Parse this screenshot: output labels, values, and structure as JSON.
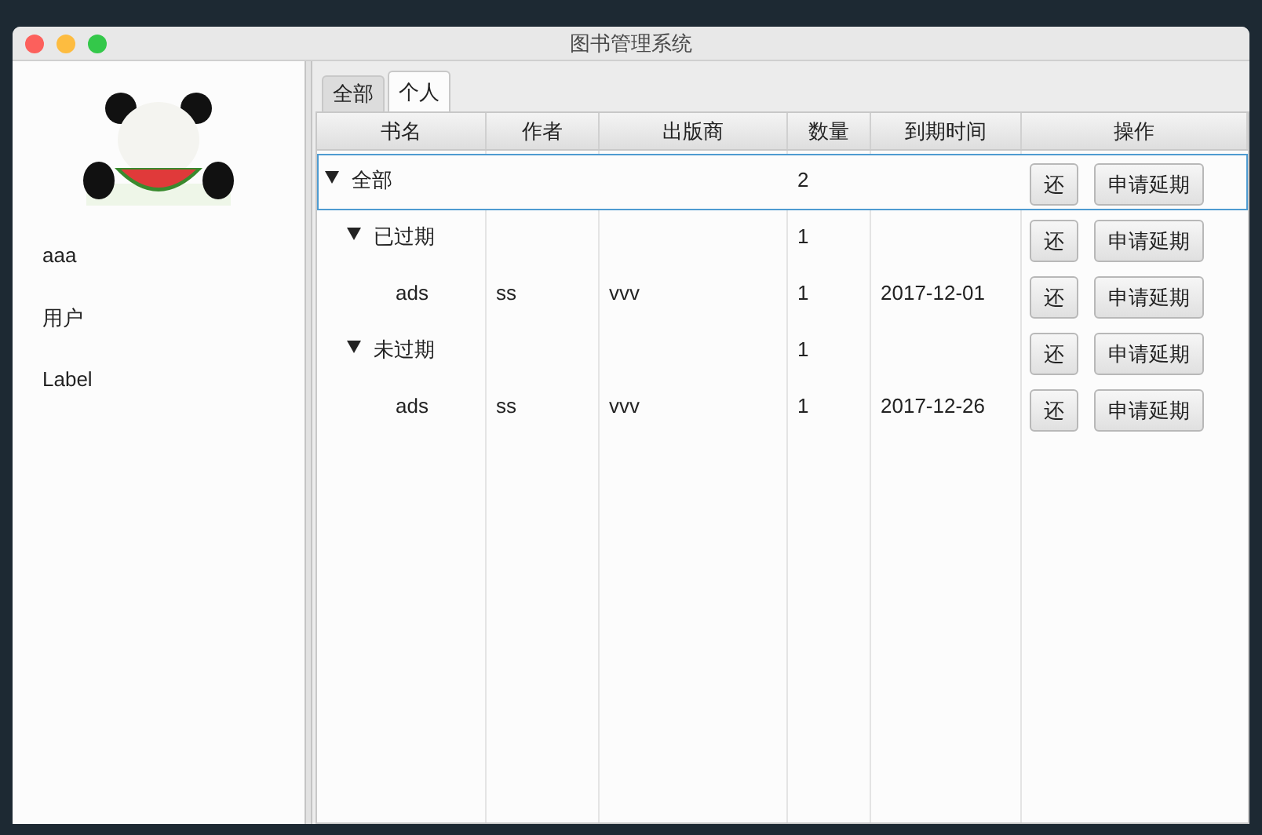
{
  "window": {
    "title": "图书管理系统"
  },
  "sidebar": {
    "items": [
      "aaa",
      "用户",
      "Label"
    ]
  },
  "tabs": [
    {
      "label": "全部",
      "selected": false
    },
    {
      "label": "个人",
      "selected": true
    }
  ],
  "table": {
    "columns": [
      "书名",
      "作者",
      "出版商",
      "数量",
      "到期时间",
      "操作"
    ],
    "rows": [
      {
        "name": "全部",
        "count": "2",
        "actions": [
          "还",
          "申请延期"
        ],
        "expanded": true,
        "selected": true,
        "children": [
          {
            "name": "已过期",
            "count": "1",
            "actions": [
              "还",
              "申请延期"
            ],
            "expanded": true,
            "selected": false,
            "children": [
              {
                "name": "ads",
                "author": "ss",
                "publisher": "vvv",
                "count": "1",
                "due": "2017-12-01",
                "actions": [
                  "还",
                  "申请延期"
                ],
                "selected": false
              }
            ]
          },
          {
            "name": "未过期",
            "count": "1",
            "actions": [
              "还",
              "申请延期"
            ],
            "expanded": true,
            "selected": false,
            "children": [
              {
                "name": "ads",
                "author": "ss",
                "publisher": "vvv",
                "count": "1",
                "due": "2017-12-26",
                "actions": [
                  "还",
                  "申请延期"
                ],
                "selected": false
              }
            ]
          }
        ]
      }
    ]
  }
}
